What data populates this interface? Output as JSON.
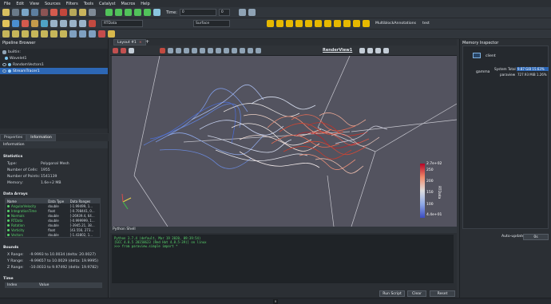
{
  "menu": [
    "File",
    "Edit",
    "View",
    "Sources",
    "Filters",
    "Tools",
    "Catalyst",
    "Macros",
    "Help"
  ],
  "toolbar": {
    "time_label": "Time:",
    "time_value": "0",
    "time_index": "0",
    "active_array": "RTData",
    "representation": "Surface",
    "extra_label_1": "MultiblockAnnotations",
    "extra_label_2": "test"
  },
  "pipeline": {
    "title": "Pipeline Browser",
    "items": [
      {
        "label": "builtin:",
        "selected": false
      },
      {
        "label": "Wavelet1",
        "selected": false
      },
      {
        "label": "RandomVectors1",
        "selected": false
      },
      {
        "label": "StreamTracer1",
        "selected": true
      }
    ]
  },
  "tabs": {
    "properties": "Properties",
    "information": "Information"
  },
  "information": {
    "heading": "Information",
    "statistics_title": "Statistics",
    "statistics": [
      {
        "key": "Type:",
        "value": "Polygonal Mesh"
      },
      {
        "key": "Number of Cells:",
        "value": "1955"
      },
      {
        "key": "Number of Points:",
        "value": "1541139"
      },
      {
        "key": "Memory:",
        "value": "1.6e+2 MB"
      }
    ],
    "data_arrays_title": "Data Arrays",
    "data_arrays_headers": [
      "Name",
      "Data Type",
      "Data Ranges"
    ],
    "data_arrays": [
      {
        "name": "AngularVelocity",
        "type": "double",
        "range": "[-1.99499, 1...",
        "color": "#59d36c"
      },
      {
        "name": "IntegrationTime",
        "type": "float",
        "range": "[-0.708441, 0...",
        "color": "#59d36c"
      },
      {
        "name": "Normals",
        "type": "double",
        "range": "[-26939.4, 64...",
        "color": "#59d36c"
      },
      {
        "name": "RTData",
        "type": "double",
        "range": "[-0.999999, 1...",
        "color": "#59d36c"
      },
      {
        "name": "Rotation",
        "type": "double",
        "range": "[-3945.21, 38...",
        "color": "#59d36c"
      },
      {
        "name": "Vorticity",
        "type": "float",
        "range": "[43.556, 273...",
        "color": "#59d36c"
      },
      {
        "name": "Vectors",
        "type": "double",
        "range": "[-1.43802, 1...",
        "color": "#59d36c"
      }
    ],
    "bounds_title": "Bounds",
    "bounds": [
      {
        "key": "X Range:",
        "value": "-9.9993 to 10.0034 (delta: 20.0027)"
      },
      {
        "key": "Y Range:",
        "value": "-9.99657 to 10.0029 (delta: 19.9995)"
      },
      {
        "key": "Z Range:",
        "value": "-10.0033 to 9.97492 (delta: 19.9782)"
      }
    ],
    "time_title": "Time",
    "time_headers": [
      "Index",
      "Value"
    ]
  },
  "layout": {
    "tab_label": "Layout #1",
    "view_label": "RenderView1"
  },
  "colorbar": {
    "title": "RTData",
    "ticks": [
      "2.7e+02",
      "250",
      "200",
      "150",
      "100",
      "4.4e+01"
    ],
    "colors": {
      "high": "#b40426",
      "mid": "#dddddd",
      "low": "#3b4cc0"
    }
  },
  "python": {
    "title": "Python Shell",
    "lines": [
      "Python 3.7.4 (default, Mar 19 2020, 09:39:54)",
      "[GCC 4.8.5 20150623 (Red Hat 4.8.5-39)] on linux",
      ">>> from paraview.simple import *"
    ],
    "run_script": "Run Script",
    "clear": "Clear",
    "reset": "Reset"
  },
  "memory": {
    "title": "Memory Inspector",
    "client_label": "client",
    "host_label": "gamma",
    "system_total_label": "System Total",
    "system_total_value": "9.87 GiB 15.63%",
    "paraview_label": "paraview",
    "paraview_value": "727.93 MiB 1.26%",
    "auto_update_label": "Auto-update",
    "update_value": "0s"
  }
}
